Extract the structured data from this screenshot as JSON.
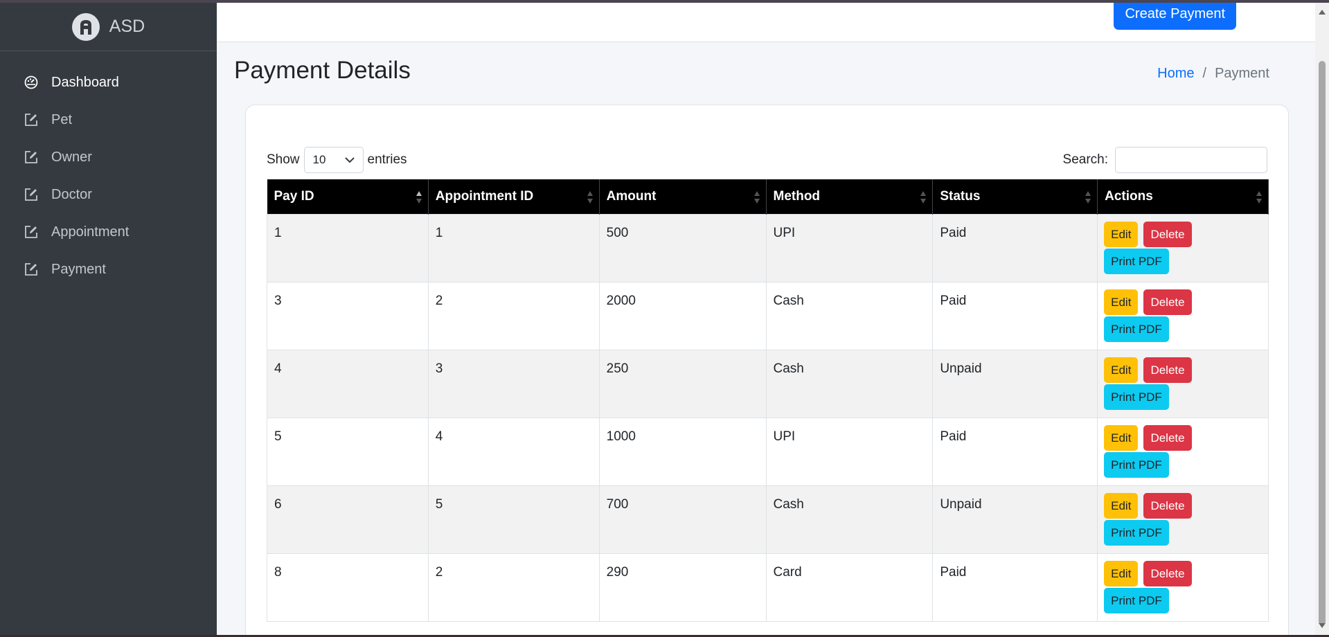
{
  "brand": {
    "name": "ASD",
    "logo_icon": "brand-logo-icon"
  },
  "sidebar": {
    "items": [
      {
        "label": "Dashboard",
        "icon": "dashboard-icon",
        "active": true
      },
      {
        "label": "Pet",
        "icon": "edit-icon"
      },
      {
        "label": "Owner",
        "icon": "edit-icon"
      },
      {
        "label": "Doctor",
        "icon": "edit-icon"
      },
      {
        "label": "Appointment",
        "icon": "edit-icon"
      },
      {
        "label": "Payment",
        "icon": "edit-icon"
      }
    ]
  },
  "topbar": {
    "create_label": "Create Payment"
  },
  "header": {
    "title": "Payment Details",
    "breadcrumb": {
      "home": "Home",
      "separator": "/",
      "current": "Payment"
    }
  },
  "datatable": {
    "show_label": "Show",
    "entries_value": "10",
    "entries_label": "entries",
    "search_label": "Search:",
    "search_value": "",
    "columns": [
      "Pay ID",
      "Appointment ID",
      "Amount",
      "Method",
      "Status",
      "Actions"
    ],
    "rows": [
      {
        "pay_id": "1",
        "appointment_id": "1",
        "amount": "500",
        "method": "UPI",
        "status": "Paid"
      },
      {
        "pay_id": "3",
        "appointment_id": "2",
        "amount": "2000",
        "method": "Cash",
        "status": "Paid"
      },
      {
        "pay_id": "4",
        "appointment_id": "3",
        "amount": "250",
        "method": "Cash",
        "status": "Unpaid"
      },
      {
        "pay_id": "5",
        "appointment_id": "4",
        "amount": "1000",
        "method": "UPI",
        "status": "Paid"
      },
      {
        "pay_id": "6",
        "appointment_id": "5",
        "amount": "700",
        "method": "Cash",
        "status": "Unpaid"
      },
      {
        "pay_id": "8",
        "appointment_id": "2",
        "amount": "290",
        "method": "Card",
        "status": "Paid"
      }
    ],
    "action_labels": {
      "edit": "Edit",
      "delete": "Delete",
      "print": "Print PDF"
    }
  },
  "colors": {
    "sidebar_bg": "#343a40",
    "primary": "#0d6efd",
    "edit": "#ffc107",
    "delete": "#dc3545",
    "print": "#0dcaf0",
    "table_header": "#000000"
  }
}
